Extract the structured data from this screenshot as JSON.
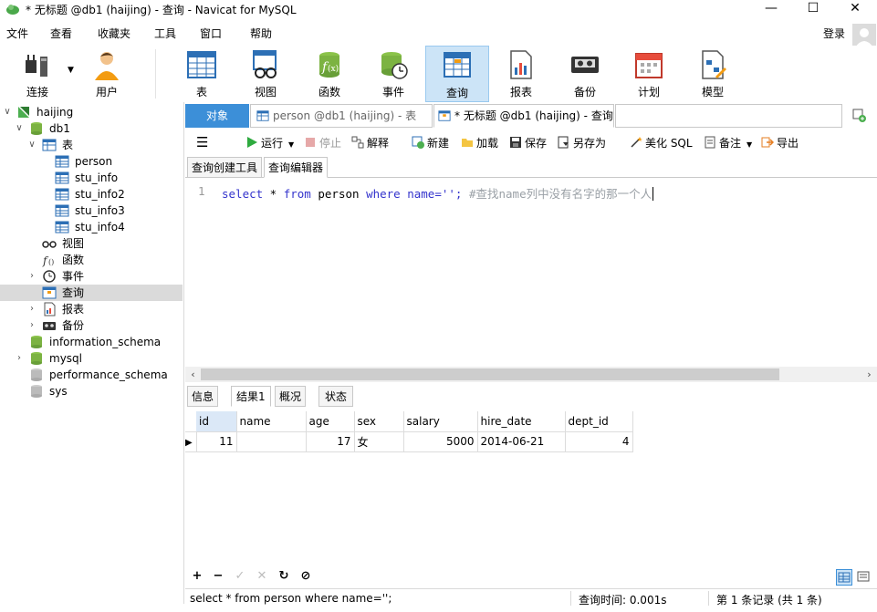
{
  "window": {
    "title": "* 无标题 @db1 (haijing) - 查询 - Navicat for MySQL",
    "controls": {
      "minimize": "—",
      "maximize": "☐",
      "close": "✕"
    }
  },
  "menu": {
    "items": [
      "文件",
      "查看",
      "收藏夹",
      "工具",
      "窗口",
      "帮助"
    ],
    "login": "登录"
  },
  "toolbar": {
    "buttons": [
      {
        "label": "连接",
        "icon": "connection-icon"
      },
      {
        "label": "用户",
        "icon": "user-icon"
      },
      {
        "label": "表",
        "icon": "table-icon"
      },
      {
        "label": "视图",
        "icon": "view-icon"
      },
      {
        "label": "函数",
        "icon": "function-icon"
      },
      {
        "label": "事件",
        "icon": "event-icon"
      },
      {
        "label": "查询",
        "icon": "query-icon"
      },
      {
        "label": "报表",
        "icon": "report-icon"
      },
      {
        "label": "备份",
        "icon": "backup-icon"
      },
      {
        "label": "计划",
        "icon": "schedule-icon"
      },
      {
        "label": "模型",
        "icon": "model-icon"
      }
    ],
    "active": "查询"
  },
  "tree": {
    "connection": "haijing",
    "database": "db1",
    "tables_group": "表",
    "tables": [
      "person",
      "stu_info",
      "stu_info2",
      "stu_info3",
      "stu_info4"
    ],
    "views": "视图",
    "functions": "函数",
    "events": "事件",
    "queries": "查询",
    "reports": "报表",
    "backups": "备份",
    "other_dbs": [
      "information_schema",
      "mysql",
      "performance_schema",
      "sys"
    ]
  },
  "tabs": {
    "objects": "对象",
    "tab1": "person @db1 (haijing) - 表",
    "tab2": "* 无标题 @db1 (haijing) - 查询"
  },
  "query_toolbar": {
    "run": "运行",
    "stop": "停止",
    "explain": "解释",
    "new": "新建",
    "load": "加载",
    "save": "保存",
    "save_as": "另存为",
    "beautify": "美化 SQL",
    "note": "备注",
    "export": "导出"
  },
  "sub_tabs": [
    "查询创建工具",
    "查询编辑器"
  ],
  "editor": {
    "line_number": "1",
    "kw_select": "select",
    "star": " * ",
    "kw_from": "from",
    "table": " person ",
    "kw_where": "where",
    "cond": " name='';",
    "comment": " #查找name列中没有名字的那一个人"
  },
  "result_tabs": [
    "信息",
    "结果1",
    "概况",
    "状态"
  ],
  "result": {
    "columns": [
      "id",
      "name",
      "age",
      "sex",
      "salary",
      "hire_date",
      "dept_id"
    ],
    "rows": [
      [
        "11",
        "",
        "17",
        "女",
        "5000",
        "2014-06-21",
        "4"
      ]
    ]
  },
  "grid_footer": {
    "add": "+",
    "remove": "−",
    "apply": "✓",
    "discard": "✕",
    "refresh": "↻",
    "stop": "⊘"
  },
  "status": {
    "sql": "select * from person where name='';",
    "time": "查询时间: 0.001s",
    "records": "第 1 条记录 (共 1 条)"
  },
  "colors": {
    "objects_tab": "#3c8fd8",
    "active_toolbar": "#cce4f7",
    "keyword": "#3333cc",
    "comment": "#9aa0a6"
  }
}
